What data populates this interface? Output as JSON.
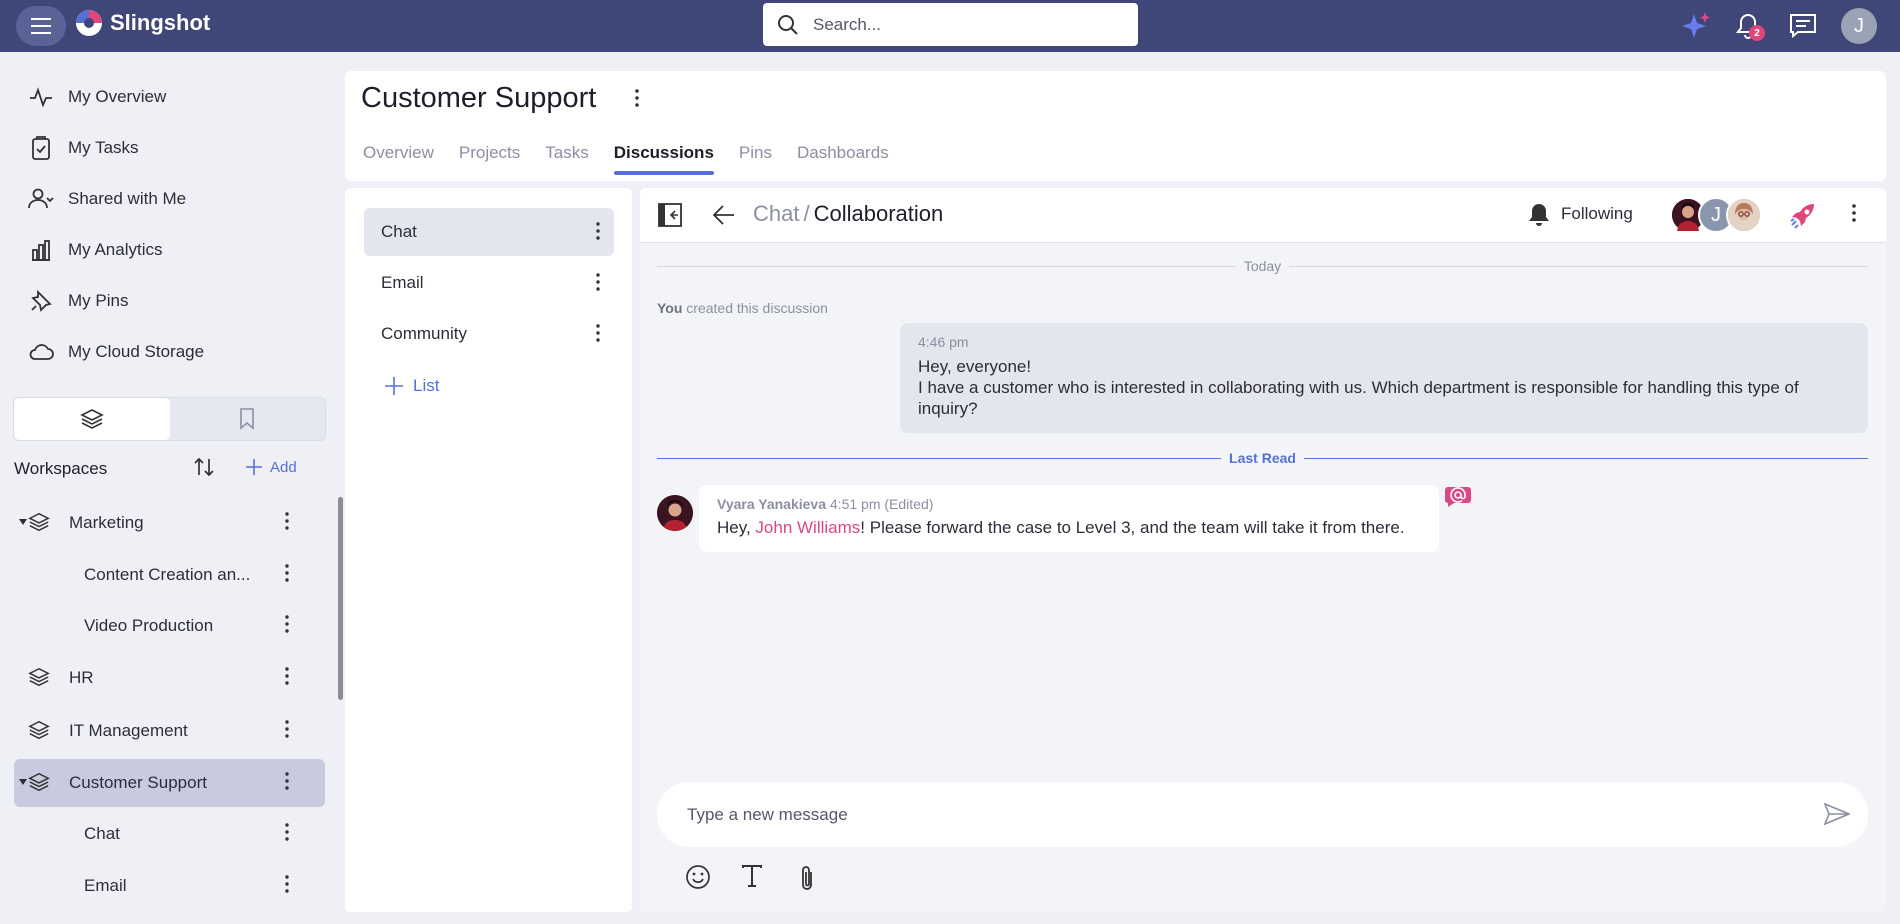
{
  "app": {
    "name": "Slingshot",
    "search_placeholder": "Search...",
    "notifications_count": "2",
    "user_initial": "J"
  },
  "sidebar": {
    "nav": [
      {
        "label": "My Overview",
        "icon": "activity-icon"
      },
      {
        "label": "My Tasks",
        "icon": "task-clipboard-icon"
      },
      {
        "label": "Shared with Me",
        "icon": "shared-user-icon"
      },
      {
        "label": "My Analytics",
        "icon": "analytics-bars-icon"
      },
      {
        "label": "My Pins",
        "icon": "pin-icon"
      },
      {
        "label": "My Cloud Storage",
        "icon": "cloud-icon"
      }
    ],
    "workspaces_title": "Workspaces",
    "add_label": "Add",
    "tree": [
      {
        "label": "Marketing",
        "type": "workspace",
        "expanded": true
      },
      {
        "label": "Content Creation an...",
        "type": "child"
      },
      {
        "label": "Video Production",
        "type": "child"
      },
      {
        "label": "HR",
        "type": "workspace"
      },
      {
        "label": "IT Management",
        "type": "workspace"
      },
      {
        "label": "Customer Support",
        "type": "workspace",
        "expanded": true,
        "selected": true
      },
      {
        "label": "Chat",
        "type": "child"
      },
      {
        "label": "Email",
        "type": "child"
      }
    ]
  },
  "header": {
    "title": "Customer Support",
    "tabs": [
      "Overview",
      "Projects",
      "Tasks",
      "Discussions",
      "Pins",
      "Dashboards"
    ],
    "active_tab": "Discussions"
  },
  "channels": {
    "items": [
      "Chat",
      "Email",
      "Community"
    ],
    "active": "Chat",
    "add_list_label": "List"
  },
  "chat": {
    "breadcrumb_parent": "Chat",
    "breadcrumb_sep": "/",
    "breadcrumb_current": "Collaboration",
    "following_label": "Following",
    "participant_initial": "J",
    "today_label": "Today",
    "sys_you": "You",
    "sys_text": "created this discussion",
    "my_message": {
      "time": "4:46 pm",
      "line1": "Hey, everyone!",
      "line2": "I have a customer who is interested in collaborating with us. Which department is responsible for handling this type of inquiry?"
    },
    "last_read_label": "Last Read",
    "reply": {
      "author": "Vyara Yanakieva",
      "time": "4:51 pm",
      "edited": "(Edited)",
      "prefix": "Hey, ",
      "mention": "John Williams",
      "suffix": "! Please forward the case to Level 3, and the team will take it from there."
    },
    "composer_placeholder": "Type a new message"
  },
  "colors": {
    "topbar": "#3e4778",
    "accent": "#5671d6",
    "mention": "#d94a84",
    "badge": "#e0457b"
  }
}
